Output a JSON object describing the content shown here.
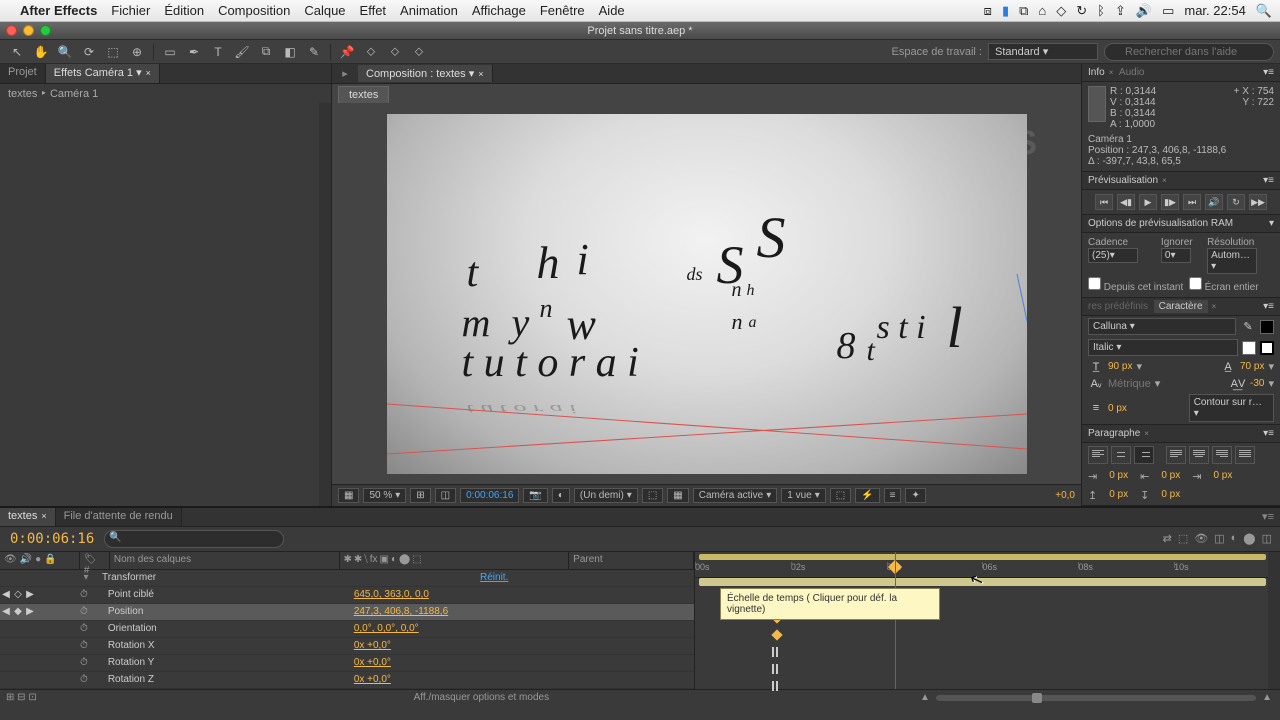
{
  "mac": {
    "app": "After Effects",
    "menus": [
      "Fichier",
      "Édition",
      "Composition",
      "Calque",
      "Effet",
      "Animation",
      "Affichage",
      "Fenêtre",
      "Aide"
    ],
    "clock": "mar. 22:54"
  },
  "window": {
    "title": "Projet sans titre.aep *"
  },
  "toolbar": {
    "workspace_label": "Espace de travail :",
    "workspace_value": "Standard",
    "search_placeholder": "Rechercher dans l'aide"
  },
  "project": {
    "tab_project": "Projet",
    "tab_effects": "Effets Caméra 1",
    "crumb": "textes ‣ Caméra 1"
  },
  "comp": {
    "panel_label": "Composition : textes",
    "tab": "textes",
    "zoom": "50 %",
    "timecode": "0:00:06:16",
    "res": "(Un demi)",
    "view_label": "Caméra active",
    "views": "1 vue",
    "exposure": "+0,0"
  },
  "info": {
    "title": "Info",
    "audio": "Audio",
    "R": "R : 0,3144",
    "V": "V : 0,3144",
    "B": "B : 0,3144",
    "A": "A : 1,0000",
    "X": "X : 754",
    "Y": "Y : 722",
    "camera": "Caméra 1",
    "position": "Position : 247,3, 406,8, -1188,6",
    "delta": "Δ : -397,7, 43,8, 65,5"
  },
  "preview": {
    "title": "Prévisualisation",
    "ram_title": "Options de prévisualisation RAM",
    "cadence_label": "Cadence",
    "cadence_value": "(25)",
    "ignorer_label": "Ignorer",
    "ignorer_value": "0",
    "resolution_label": "Résolution",
    "resolution_value": "Autom…",
    "from_current": "Depuis cet instant",
    "fullscreen": "Écran entier"
  },
  "character": {
    "preset_title": "res prédéfinis",
    "title": "Caractère",
    "font": "Calluna",
    "style": "Italic",
    "size": "90 px",
    "leading": "70 px",
    "kerning": "Métrique",
    "tracking": "-30",
    "stroke": "0 px",
    "stroke_mode": "Contour sur r…"
  },
  "paragraph": {
    "title": "Paragraphe",
    "v0": "0 px"
  },
  "timeline": {
    "tab_textes": "textes",
    "tab_render": "File d'attente de rendu",
    "timecode": "0:00:06:16",
    "col_num": "#",
    "col_name": "Nom des calques",
    "col_parent": "Parent",
    "transform": "Transformer",
    "reset": "Réinit.",
    "rows": [
      {
        "name": "Point ciblé",
        "value": "645,0, 363,0, 0,0"
      },
      {
        "name": "Position",
        "value": "247,3, 406,8, -1188,6",
        "sel": true
      },
      {
        "name": "Orientation",
        "value": "0,0°, 0,0°, 0,0°"
      },
      {
        "name": "Rotation X",
        "value": "0x +0,0°"
      },
      {
        "name": "Rotation Y",
        "value": "0x +0,0°"
      },
      {
        "name": "Rotation Z",
        "value": "0x +0,0°"
      }
    ],
    "ruler": [
      "00s",
      "02s",
      "04s",
      "06s",
      "08s",
      "10s"
    ],
    "tooltip": "Échelle de temps ( Cliquer pour déf. la vignette)",
    "footer": "Aff./masquer options et modes"
  }
}
